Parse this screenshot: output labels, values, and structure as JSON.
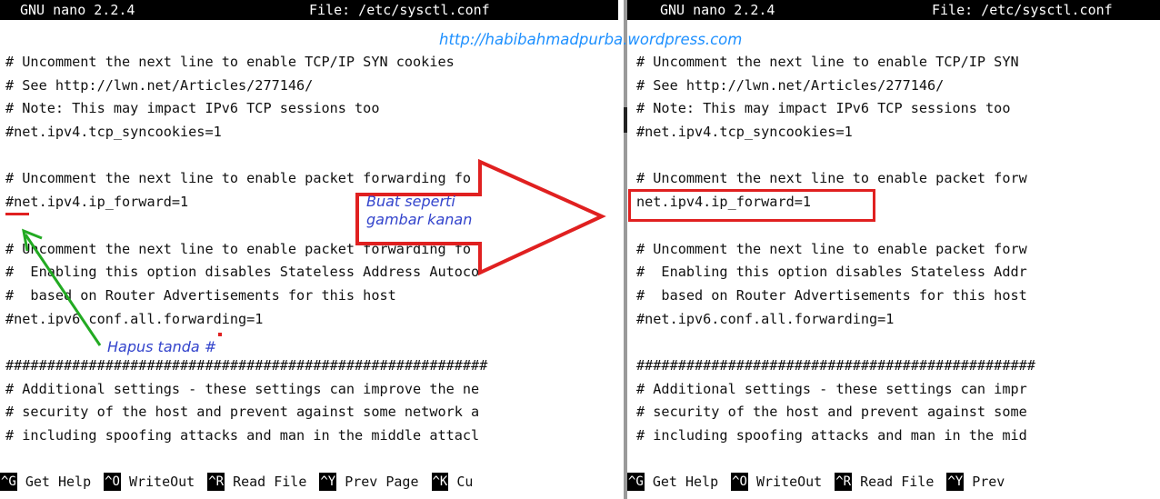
{
  "editor": {
    "program": "GNU nano 2.2.4",
    "file": "File: /etc/sysctl.conf"
  },
  "left_pane": {
    "lines": [
      "# Uncomment the next line to enable TCP/IP SYN cookies",
      "# See http://lwn.net/Articles/277146/",
      "# Note: This may impact IPv6 TCP sessions too",
      "#net.ipv4.tcp_syncookies=1",
      "",
      "# Uncomment the next line to enable packet forwarding fo",
      "#net.ipv4.ip_forward=1",
      "",
      "# Uncomment the next line to enable packet forwarding fo",
      "#  Enabling this option disables Stateless Address Autoco",
      "#  based on Router Advertisements for this host",
      "#net.ipv6.conf.all.forwarding=1",
      "",
      "##########################################################",
      "# Additional settings - these settings can improve the ne",
      "# security of the host and prevent against some network a",
      "# including spoofing attacks and man in the middle attacl"
    ],
    "shortcuts": [
      {
        "key": "^G",
        "label": "Get Help"
      },
      {
        "key": "^O",
        "label": "WriteOut"
      },
      {
        "key": "^R",
        "label": "Read File"
      },
      {
        "key": "^Y",
        "label": "Prev Page"
      },
      {
        "key": "^K",
        "label": "Cu"
      }
    ]
  },
  "right_pane": {
    "lines": [
      "# Uncomment the next line to enable TCP/IP SYN",
      "# See http://lwn.net/Articles/277146/",
      "# Note: This may impact IPv6 TCP sessions too",
      "#net.ipv4.tcp_syncookies=1",
      "",
      "# Uncomment the next line to enable packet forw",
      "net.ipv4.ip_forward=1",
      "",
      "# Uncomment the next line to enable packet forw",
      "#  Enabling this option disables Stateless Addr",
      "#  based on Router Advertisements for this host",
      "#net.ipv6.conf.all.forwarding=1",
      "",
      "################################################",
      "# Additional settings - these settings can impr",
      "# security of the host and prevent against some",
      "# including spoofing attacks and man in the mid"
    ],
    "shortcuts": [
      {
        "key": "^G",
        "label": "Get Help"
      },
      {
        "key": "^O",
        "label": "WriteOut"
      },
      {
        "key": "^R",
        "label": "Read File"
      },
      {
        "key": "^Y",
        "label": "Prev"
      }
    ]
  },
  "annotations": {
    "watermark": "http://habibahmadpurba.wordpress.com",
    "arrow_note": "Buat seperti\ngambar kanan",
    "remove_note": "Hapus tanda #"
  },
  "colors": {
    "annotation_red": "#e02020",
    "arrow_green": "#22aa22",
    "watermark_blue": "#1e90ff",
    "note_blue": "#3344cc"
  }
}
